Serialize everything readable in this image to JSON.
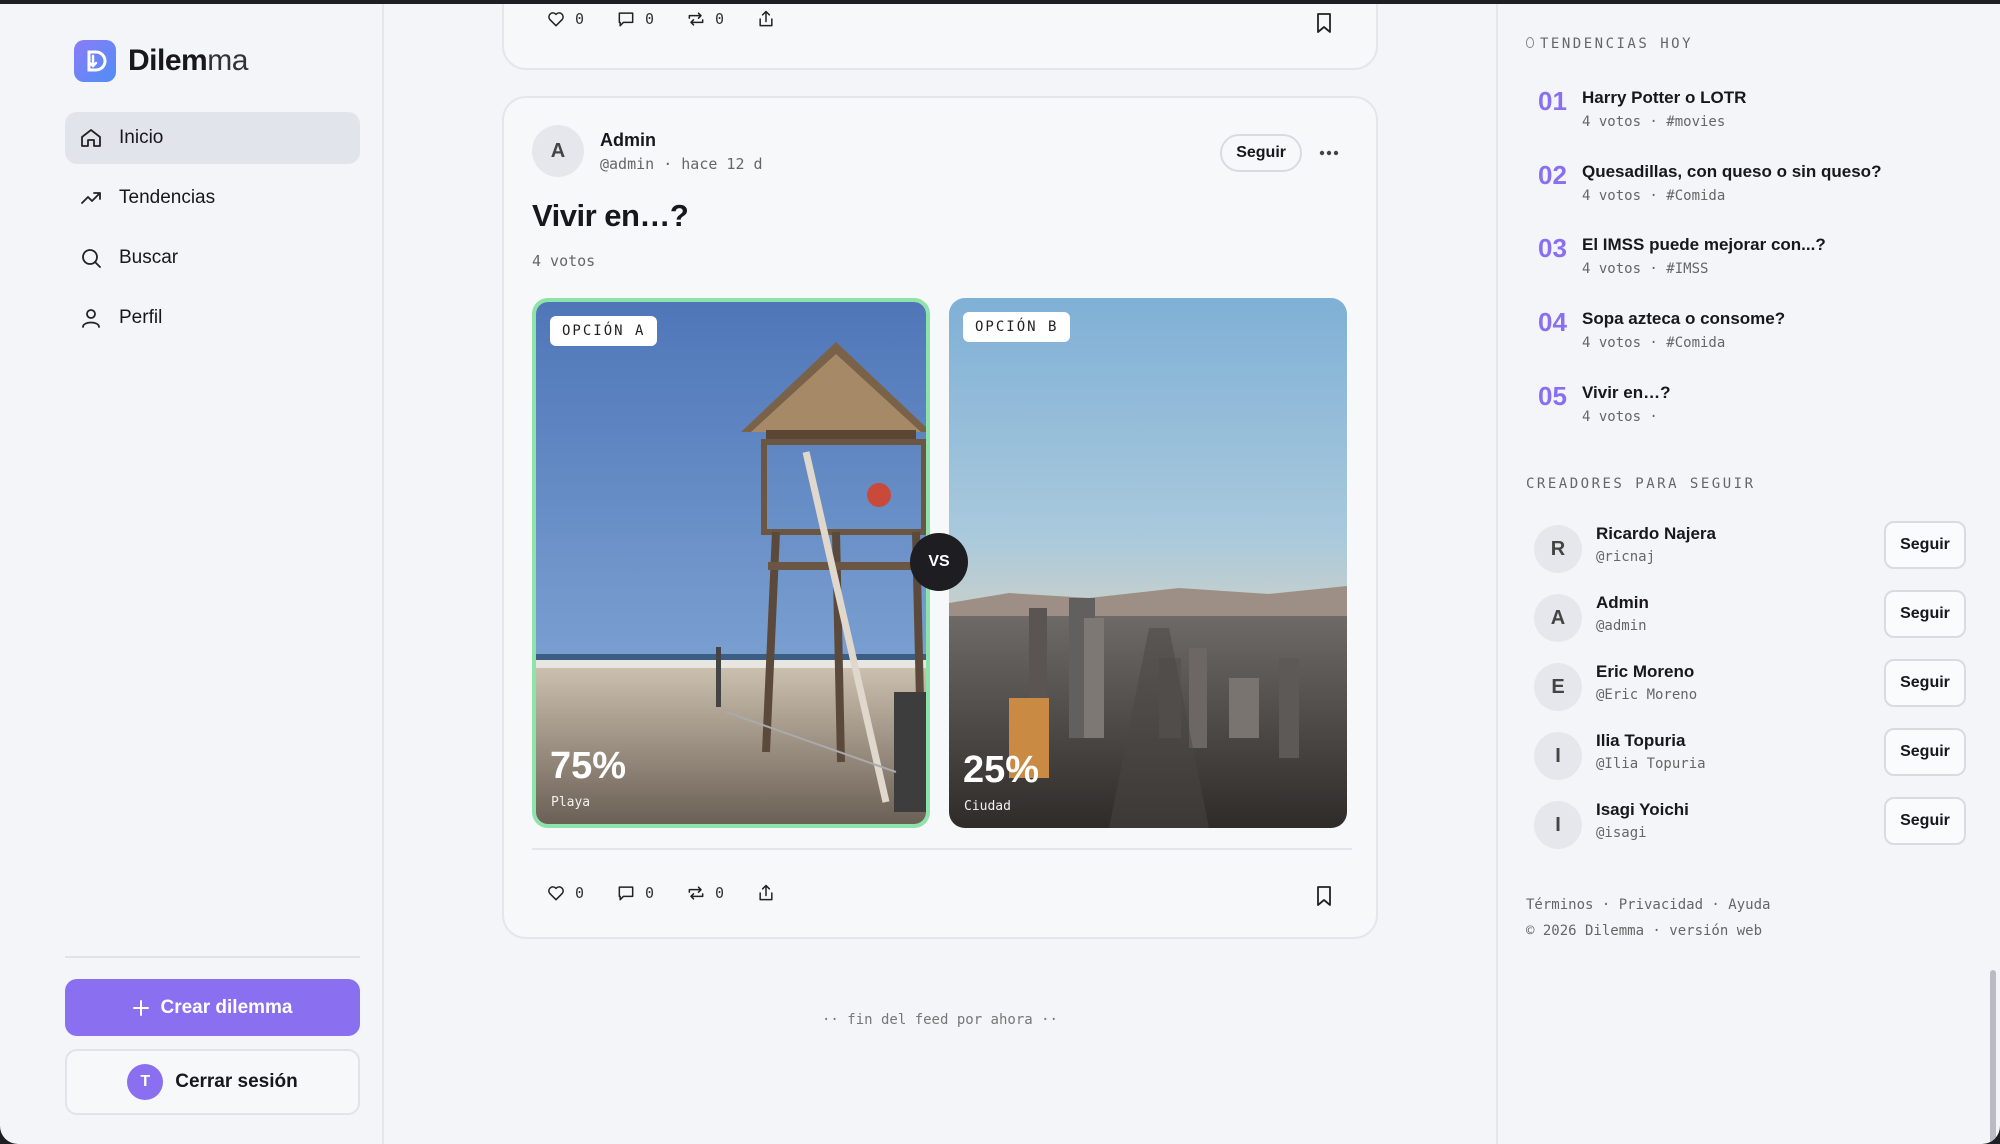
{
  "app": {
    "name_bold": "Dilem",
    "name_light": "ma"
  },
  "nav": [
    {
      "label": "Inicio",
      "icon": "home-icon",
      "active": true
    },
    {
      "label": "Tendencias",
      "icon": "trending-icon",
      "active": false
    },
    {
      "label": "Buscar",
      "icon": "search-icon",
      "active": false
    },
    {
      "label": "Perfil",
      "icon": "user-icon",
      "active": false
    }
  ],
  "sidebar": {
    "create_label": "Crear dilemma",
    "logout_label": "Cerrar sesión",
    "logout_avatar": "T"
  },
  "prev_post": {
    "likes": "0",
    "comments": "0",
    "reposts": "0"
  },
  "post": {
    "author": "Admin",
    "avatar": "A",
    "meta": "@admin · hace 12 d",
    "follow_label": "Seguir",
    "title": "Vivir en…?",
    "votes": "4 votos",
    "option_a": {
      "tag": "OPCIÓN A",
      "percent": "75%",
      "label": "Playa"
    },
    "option_b": {
      "tag": "OPCIÓN B",
      "percent": "25%",
      "label": "Ciudad"
    },
    "vs": "VS",
    "likes": "0",
    "comments": "0",
    "reposts": "0"
  },
  "feed_end": "·· fin del feed por ahora ··",
  "trends": {
    "label": "TENDENCIAS HOY",
    "items": [
      {
        "num": "01",
        "title": "Harry Potter o LOTR",
        "meta": "4 votos · #movies"
      },
      {
        "num": "02",
        "title": "Quesadillas, con queso o sin queso?",
        "meta": "4 votos · #Comida"
      },
      {
        "num": "03",
        "title": "El IMSS puede mejorar con...?",
        "meta": "4 votos · #IMSS"
      },
      {
        "num": "04",
        "title": "Sopa azteca o consome?",
        "meta": "4 votos · #Comida"
      },
      {
        "num": "05",
        "title": "Vivir en…?",
        "meta": "4 votos ·"
      }
    ]
  },
  "creators": {
    "label": "CREADORES PARA SEGUIR",
    "follow_label": "Seguir",
    "items": [
      {
        "initial": "R",
        "name": "Ricardo Najera",
        "handle": "@ricnaj"
      },
      {
        "initial": "A",
        "name": "Admin",
        "handle": "@admin"
      },
      {
        "initial": "E",
        "name": "Eric Moreno",
        "handle": "@Eric Moreno"
      },
      {
        "initial": "I",
        "name": "Ilia Topuria",
        "handle": "@Ilia Topuria"
      },
      {
        "initial": "I",
        "name": "Isagi Yoichi",
        "handle": "@isagi"
      }
    ]
  },
  "footer": {
    "links": "Términos · Privacidad · Ayuda",
    "copyright": "© 2026 Dilemma · versión web"
  },
  "colors": {
    "accent": "#8a6ff0",
    "selected_border": "#8ee3a8"
  }
}
